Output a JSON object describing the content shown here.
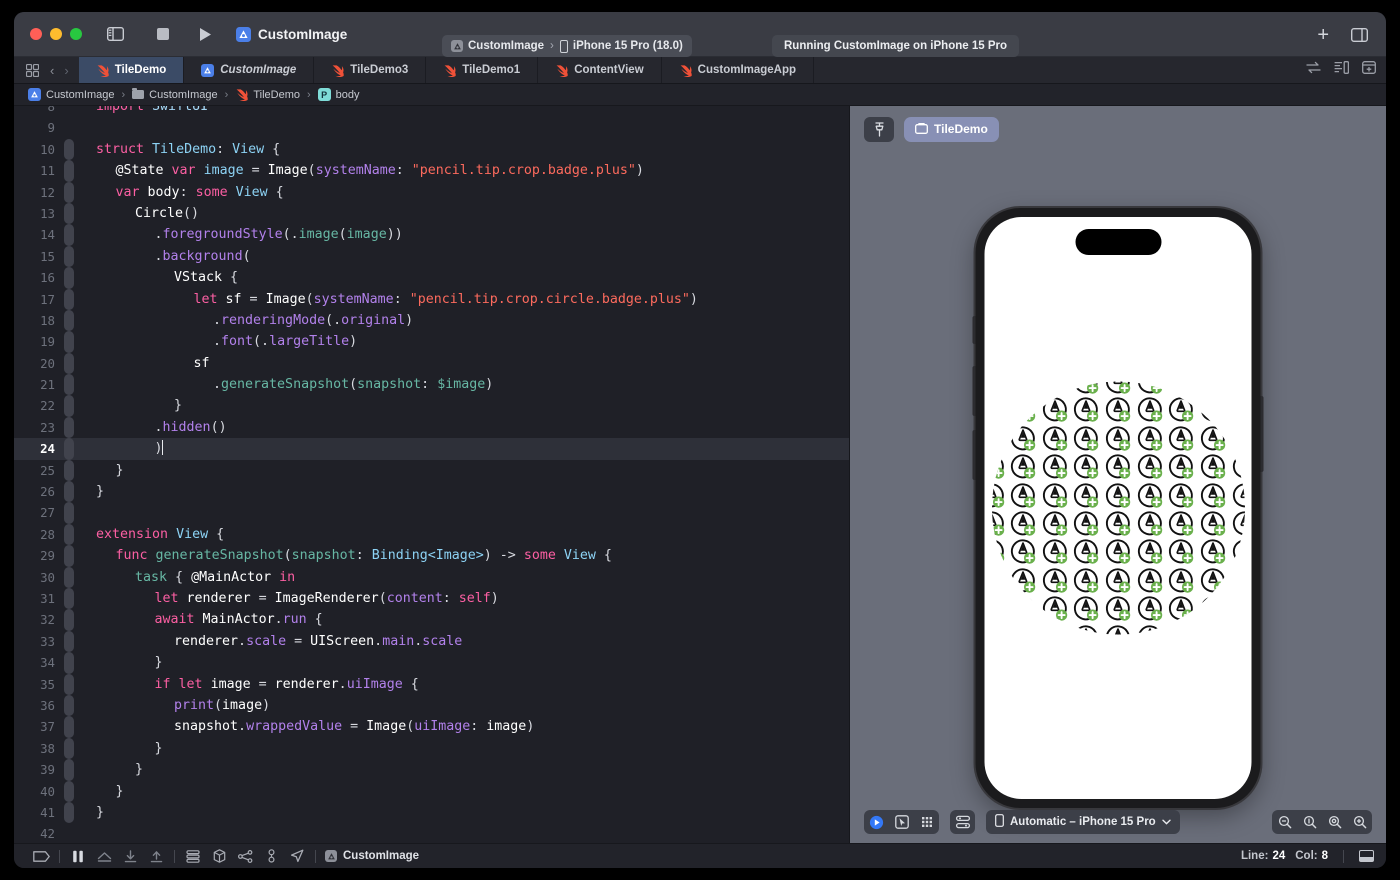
{
  "window": {
    "scheme_name": "CustomImage",
    "destination_project": "CustomImage",
    "destination_device": "iPhone 15 Pro (18.0)",
    "destination_separator": "›",
    "status_message": "Running CustomImage on iPhone 15 Pro"
  },
  "tabs": [
    {
      "label": "TileDemo",
      "icon": "swift-file-icon",
      "active": true,
      "italic": false
    },
    {
      "label": "CustomImage",
      "icon": "xcode-project-icon",
      "active": false,
      "italic": true
    },
    {
      "label": "TileDemo3",
      "icon": "swift-file-icon",
      "active": false,
      "italic": false
    },
    {
      "label": "TileDemo1",
      "icon": "swift-file-icon",
      "active": false,
      "italic": false
    },
    {
      "label": "ContentView",
      "icon": "swift-file-icon",
      "active": false,
      "italic": false
    },
    {
      "label": "CustomImageApp",
      "icon": "swift-file-icon",
      "active": false,
      "italic": false
    }
  ],
  "breadcrumb": [
    {
      "label": "CustomImage",
      "icon": "xcode-project-icon"
    },
    {
      "label": "CustomImage",
      "icon": "folder-icon"
    },
    {
      "label": "TileDemo",
      "icon": "swift-file-icon"
    },
    {
      "label": "body",
      "icon": "property-badge-icon"
    }
  ],
  "editor": {
    "current_line": 24,
    "cursor_column": 8,
    "first_visible_line": 8,
    "lines": [
      {
        "n": 8,
        "tokens": [
          {
            "t": "import ",
            "c": "k"
          },
          {
            "t": "SwiftUI",
            "c": "ty2"
          }
        ],
        "indent": 0,
        "clipped": true
      },
      {
        "n": 9,
        "tokens": [],
        "indent": 0
      },
      {
        "n": 10,
        "tokens": [
          {
            "t": "struct ",
            "c": "k"
          },
          {
            "t": "TileDemo",
            "c": "t"
          },
          {
            "t": ": ",
            "c": "pl"
          },
          {
            "t": "View",
            "c": "t"
          },
          {
            "t": " {",
            "c": "pl"
          }
        ],
        "indent": 0
      },
      {
        "n": 11,
        "tokens": [
          {
            "t": "@State ",
            "c": "id"
          },
          {
            "t": "var ",
            "c": "k"
          },
          {
            "t": "image",
            "c": "t"
          },
          {
            "t": " = ",
            "c": "pl"
          },
          {
            "t": "Image",
            "c": "id"
          },
          {
            "t": "(",
            "c": "pl"
          },
          {
            "t": "systemName",
            "c": "p"
          },
          {
            "t": ": ",
            "c": "pl"
          },
          {
            "t": "\"pencil.tip.crop.badge.plus\"",
            "c": "s"
          },
          {
            "t": ")",
            "c": "pl"
          }
        ],
        "indent": 1
      },
      {
        "n": 12,
        "tokens": [
          {
            "t": "var ",
            "c": "k"
          },
          {
            "t": "body",
            "c": "id"
          },
          {
            "t": ": ",
            "c": "pl"
          },
          {
            "t": "some ",
            "c": "k"
          },
          {
            "t": "View",
            "c": "t"
          },
          {
            "t": " {",
            "c": "pl"
          }
        ],
        "indent": 1
      },
      {
        "n": 13,
        "tokens": [
          {
            "t": "Circle",
            "c": "id"
          },
          {
            "t": "()",
            "c": "pl"
          }
        ],
        "indent": 2
      },
      {
        "n": 14,
        "tokens": [
          {
            "t": ".",
            "c": "pl"
          },
          {
            "t": "foregroundStyle",
            "c": "p"
          },
          {
            "t": "(.",
            "c": "pl"
          },
          {
            "t": "image",
            "c": "fn"
          },
          {
            "t": "(",
            "c": "pl"
          },
          {
            "t": "image",
            "c": "fn"
          },
          {
            "t": "))",
            "c": "pl"
          }
        ],
        "indent": 3
      },
      {
        "n": 15,
        "tokens": [
          {
            "t": ".",
            "c": "pl"
          },
          {
            "t": "background",
            "c": "p"
          },
          {
            "t": "(",
            "c": "pl"
          }
        ],
        "indent": 3
      },
      {
        "n": 16,
        "tokens": [
          {
            "t": "VStack",
            "c": "id"
          },
          {
            "t": " {",
            "c": "pl"
          }
        ],
        "indent": 4
      },
      {
        "n": 17,
        "tokens": [
          {
            "t": "let ",
            "c": "k"
          },
          {
            "t": "sf",
            "c": "id"
          },
          {
            "t": " = ",
            "c": "pl"
          },
          {
            "t": "Image",
            "c": "id"
          },
          {
            "t": "(",
            "c": "pl"
          },
          {
            "t": "systemName",
            "c": "p"
          },
          {
            "t": ": ",
            "c": "pl"
          },
          {
            "t": "\"pencil.tip.crop.circle.badge.plus\"",
            "c": "s"
          },
          {
            "t": ")",
            "c": "pl"
          }
        ],
        "indent": 5
      },
      {
        "n": 18,
        "tokens": [
          {
            "t": ".",
            "c": "pl"
          },
          {
            "t": "renderingMode",
            "c": "p"
          },
          {
            "t": "(.",
            "c": "pl"
          },
          {
            "t": "original",
            "c": "p"
          },
          {
            "t": ")",
            "c": "pl"
          }
        ],
        "indent": 6
      },
      {
        "n": 19,
        "tokens": [
          {
            "t": ".",
            "c": "pl"
          },
          {
            "t": "font",
            "c": "p"
          },
          {
            "t": "(.",
            "c": "pl"
          },
          {
            "t": "largeTitle",
            "c": "p"
          },
          {
            "t": ")",
            "c": "pl"
          }
        ],
        "indent": 6
      },
      {
        "n": 20,
        "tokens": [
          {
            "t": "sf",
            "c": "id"
          }
        ],
        "indent": 5
      },
      {
        "n": 21,
        "tokens": [
          {
            "t": ".",
            "c": "pl"
          },
          {
            "t": "generateSnapshot",
            "c": "fn"
          },
          {
            "t": "(",
            "c": "pl"
          },
          {
            "t": "snapshot",
            "c": "fn"
          },
          {
            "t": ": ",
            "c": "pl"
          },
          {
            "t": "$image",
            "c": "fn"
          },
          {
            "t": ")",
            "c": "pl"
          }
        ],
        "indent": 6
      },
      {
        "n": 22,
        "tokens": [
          {
            "t": "}",
            "c": "pl"
          }
        ],
        "indent": 4
      },
      {
        "n": 23,
        "tokens": [
          {
            "t": ".",
            "c": "pl"
          },
          {
            "t": "hidden",
            "c": "p"
          },
          {
            "t": "()",
            "c": "pl"
          }
        ],
        "indent": 3
      },
      {
        "n": 24,
        "tokens": [
          {
            "t": ")",
            "c": "pl"
          }
        ],
        "indent": 3,
        "current": true
      },
      {
        "n": 25,
        "tokens": [
          {
            "t": "}",
            "c": "pl"
          }
        ],
        "indent": 1
      },
      {
        "n": 26,
        "tokens": [
          {
            "t": "}",
            "c": "pl"
          }
        ],
        "indent": 0
      },
      {
        "n": 27,
        "tokens": [],
        "indent": 0
      },
      {
        "n": 28,
        "tokens": [
          {
            "t": "extension ",
            "c": "k"
          },
          {
            "t": "View",
            "c": "t"
          },
          {
            "t": " {",
            "c": "pl"
          }
        ],
        "indent": 0
      },
      {
        "n": 29,
        "tokens": [
          {
            "t": "func ",
            "c": "k"
          },
          {
            "t": "generateSnapshot",
            "c": "fn"
          },
          {
            "t": "(",
            "c": "pl"
          },
          {
            "t": "snapshot",
            "c": "fn"
          },
          {
            "t": ": ",
            "c": "pl"
          },
          {
            "t": "Binding<Image>",
            "c": "t"
          },
          {
            "t": ") ",
            "c": "pl"
          },
          {
            "t": "-> ",
            "c": "pl"
          },
          {
            "t": "some ",
            "c": "k"
          },
          {
            "t": "View",
            "c": "t"
          },
          {
            "t": " {",
            "c": "pl"
          }
        ],
        "indent": 1
      },
      {
        "n": 30,
        "tokens": [
          {
            "t": "task",
            "c": "fn"
          },
          {
            "t": " { ",
            "c": "pl"
          },
          {
            "t": "@MainActor",
            "c": "id"
          },
          {
            "t": " ",
            "c": "pl"
          },
          {
            "t": "in",
            "c": "k"
          }
        ],
        "indent": 2
      },
      {
        "n": 31,
        "tokens": [
          {
            "t": "let ",
            "c": "k"
          },
          {
            "t": "renderer",
            "c": "id"
          },
          {
            "t": " = ",
            "c": "pl"
          },
          {
            "t": "ImageRenderer",
            "c": "id"
          },
          {
            "t": "(",
            "c": "pl"
          },
          {
            "t": "content",
            "c": "p"
          },
          {
            "t": ": ",
            "c": "pl"
          },
          {
            "t": "self",
            "c": "k"
          },
          {
            "t": ")",
            "c": "pl"
          }
        ],
        "indent": 3
      },
      {
        "n": 32,
        "tokens": [
          {
            "t": "await ",
            "c": "k"
          },
          {
            "t": "MainActor",
            "c": "id"
          },
          {
            "t": ".",
            "c": "pl"
          },
          {
            "t": "run",
            "c": "p"
          },
          {
            "t": " {",
            "c": "pl"
          }
        ],
        "indent": 3
      },
      {
        "n": 33,
        "tokens": [
          {
            "t": "renderer",
            "c": "id"
          },
          {
            "t": ".",
            "c": "pl"
          },
          {
            "t": "scale",
            "c": "p"
          },
          {
            "t": " = ",
            "c": "pl"
          },
          {
            "t": "UIScreen",
            "c": "id"
          },
          {
            "t": ".",
            "c": "pl"
          },
          {
            "t": "main",
            "c": "p"
          },
          {
            "t": ".",
            "c": "pl"
          },
          {
            "t": "scale",
            "c": "p"
          }
        ],
        "indent": 4
      },
      {
        "n": 34,
        "tokens": [
          {
            "t": "}",
            "c": "pl"
          }
        ],
        "indent": 3
      },
      {
        "n": 35,
        "tokens": [
          {
            "t": "if ",
            "c": "k"
          },
          {
            "t": "let ",
            "c": "k"
          },
          {
            "t": "image",
            "c": "id"
          },
          {
            "t": " = ",
            "c": "pl"
          },
          {
            "t": "renderer",
            "c": "id"
          },
          {
            "t": ".",
            "c": "pl"
          },
          {
            "t": "uiImage",
            "c": "p"
          },
          {
            "t": " {",
            "c": "pl"
          }
        ],
        "indent": 3
      },
      {
        "n": 36,
        "tokens": [
          {
            "t": "print",
            "c": "p"
          },
          {
            "t": "(",
            "c": "pl"
          },
          {
            "t": "image",
            "c": "id"
          },
          {
            "t": ")",
            "c": "pl"
          }
        ],
        "indent": 4
      },
      {
        "n": 37,
        "tokens": [
          {
            "t": "snapshot",
            "c": "id"
          },
          {
            "t": ".",
            "c": "pl"
          },
          {
            "t": "wrappedValue",
            "c": "p"
          },
          {
            "t": " = ",
            "c": "pl"
          },
          {
            "t": "Image",
            "c": "id"
          },
          {
            "t": "(",
            "c": "pl"
          },
          {
            "t": "uiImage",
            "c": "p"
          },
          {
            "t": ": ",
            "c": "pl"
          },
          {
            "t": "image",
            "c": "id"
          },
          {
            "t": ")",
            "c": "pl"
          }
        ],
        "indent": 4
      },
      {
        "n": 38,
        "tokens": [
          {
            "t": "}",
            "c": "pl"
          }
        ],
        "indent": 3
      },
      {
        "n": 39,
        "tokens": [
          {
            "t": "}",
            "c": "pl"
          }
        ],
        "indent": 2
      },
      {
        "n": 40,
        "tokens": [
          {
            "t": "}",
            "c": "pl"
          }
        ],
        "indent": 1
      },
      {
        "n": 41,
        "tokens": [
          {
            "t": "}",
            "c": "pl"
          }
        ],
        "indent": 0
      },
      {
        "n": 42,
        "tokens": [],
        "indent": 0,
        "clipped": true
      }
    ]
  },
  "preview": {
    "pin_icon": "pin-icon",
    "chip_label": "TileDemo",
    "chip_icon": "preview-variant-icon",
    "device_selector_label": "Automatic – iPhone 15 Pro",
    "device_selector_chevron": "chevron-down-icon",
    "controls": [
      {
        "name": "live-preview-button",
        "icon": "play-circle-icon"
      },
      {
        "name": "selectable-preview-button",
        "icon": "pointer-frame-icon"
      },
      {
        "name": "variants-button",
        "icon": "grid-dots-icon"
      },
      {
        "name": "device-settings-button",
        "icon": "device-settings-icon"
      }
    ],
    "zoom_controls": [
      {
        "name": "zoom-out-button",
        "icon": "zoom-out-icon"
      },
      {
        "name": "zoom-to-fit-button",
        "icon": "zoom-fit-icon"
      },
      {
        "name": "zoom-100-button",
        "icon": "zoom-actual-icon"
      },
      {
        "name": "zoom-in-button",
        "icon": "zoom-in-icon"
      }
    ],
    "tile_symbol": "pencil.tip.crop.circle.badge.plus",
    "tile_badge_color": "#6ab04c",
    "tile_stroke_color": "#111111",
    "tile_rows": 10,
    "tile_cols": 9,
    "screen_background": "#ffffff"
  },
  "statusbar": {
    "icons": [
      {
        "name": "breakpoint-toggle-button",
        "icon": "breakpoint-icon"
      },
      {
        "name": "pause-button",
        "icon": "pause-icon"
      },
      {
        "name": "step-over-button",
        "icon": "step-over-icon"
      },
      {
        "name": "step-into-button",
        "icon": "step-into-icon"
      },
      {
        "name": "step-out-button",
        "icon": "step-out-icon"
      },
      {
        "name": "debug-view-hierarchy-button",
        "icon": "stack-layers-icon"
      },
      {
        "name": "view-debugger-button",
        "icon": "cube-icon"
      },
      {
        "name": "memory-graph-button",
        "icon": "memory-graph-icon"
      },
      {
        "name": "environment-overrides-button",
        "icon": "environment-icon"
      },
      {
        "name": "simulate-location-button",
        "icon": "location-arrow-icon"
      }
    ],
    "process_label": "CustomImage",
    "line_label": "Line:",
    "line_value": "24",
    "col_label": "Col:",
    "col_value": "8",
    "console_icon": "console-toggle-icon"
  },
  "colors": {
    "accent": "#4b7fe8",
    "active_tab": "#3b4b66",
    "preview_chip": "#8890b5",
    "titlebar": "#3a3c44",
    "editor_bg": "#1f2027",
    "canvas_bg": "#6a6e7a"
  }
}
